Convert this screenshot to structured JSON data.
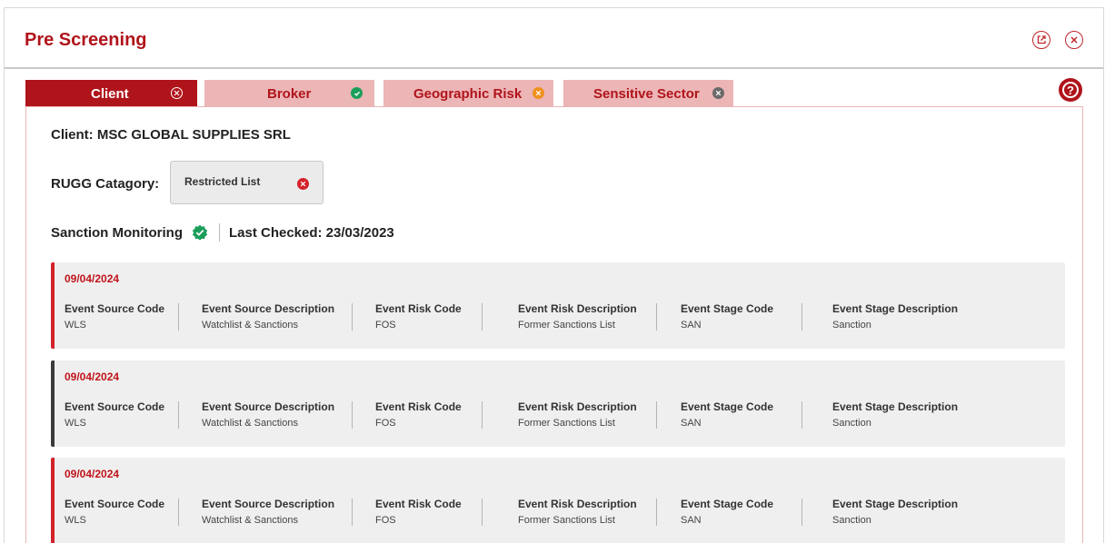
{
  "header": {
    "title": "Pre Screening",
    "icons": [
      "external-link-icon",
      "close-icon"
    ]
  },
  "tabs": [
    {
      "label": "Client",
      "status": "close",
      "active": true
    },
    {
      "label": "Broker",
      "status": "check",
      "active": false
    },
    {
      "label": "Geographic Risk",
      "status": "warning",
      "active": false
    },
    {
      "label": "Sensitive Sector",
      "status": "neutral",
      "active": false
    }
  ],
  "client": {
    "line": "Client: MSC GLOBAL SUPPLIES SRL"
  },
  "rugg": {
    "label": "RUGG Catagory:",
    "value": "Restricted List"
  },
  "sanction": {
    "label": "Sanction Monitoring",
    "last_checked": "Last Checked: 23/03/2023"
  },
  "events": [
    {
      "date": "09/04/2024",
      "fields": [
        {
          "label": "Event Source Code",
          "value": "WLS"
        },
        {
          "label": "Event Source Description",
          "value": "Watchlist & Sanctions"
        },
        {
          "label": "Event Risk Code",
          "value": "FOS"
        },
        {
          "label": "Event Risk Description",
          "value": "Former Sanctions List"
        },
        {
          "label": "Event Stage Code",
          "value": "SAN"
        },
        {
          "label": "Event Stage Description",
          "value": "Sanction"
        }
      ]
    },
    {
      "date": "09/04/2024",
      "fields": [
        {
          "label": "Event Source Code",
          "value": "WLS"
        },
        {
          "label": "Event Source Description",
          "value": "Watchlist & Sanctions"
        },
        {
          "label": "Event Risk Code",
          "value": "FOS"
        },
        {
          "label": "Event Risk Description",
          "value": "Former Sanctions List"
        },
        {
          "label": "Event Stage Code",
          "value": "SAN"
        },
        {
          "label": "Event Stage Description",
          "value": "Sanction"
        }
      ]
    },
    {
      "date": "09/04/2024",
      "fields": [
        {
          "label": "Event Source Code",
          "value": "WLS"
        },
        {
          "label": "Event Source Description",
          "value": "Watchlist & Sanctions"
        },
        {
          "label": "Event Risk Code",
          "value": "FOS"
        },
        {
          "label": "Event Risk Description",
          "value": "Former Sanctions List"
        },
        {
          "label": "Event Stage Code",
          "value": "SAN"
        },
        {
          "label": "Event Stage Description",
          "value": "Sanction"
        }
      ]
    }
  ],
  "colors": {
    "brand": "#b0141b",
    "tab_inactive": "#ecb5b6",
    "success": "#1a9e5a",
    "warning": "#f0901e",
    "neutral": "#6a6a6a",
    "error": "#d3222a"
  }
}
